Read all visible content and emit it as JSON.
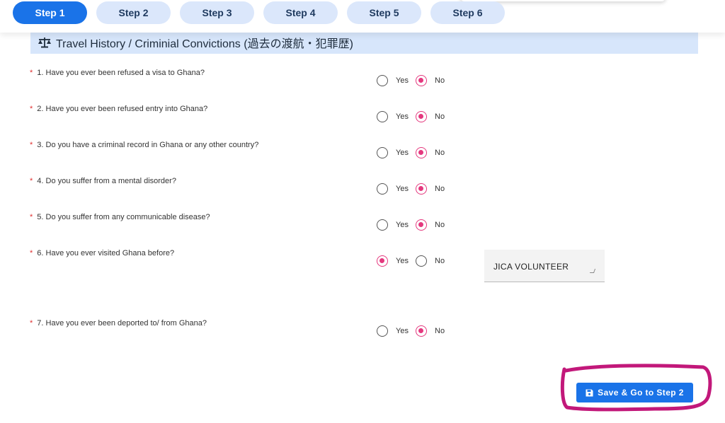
{
  "steps": [
    {
      "label": "Step 1",
      "active": true
    },
    {
      "label": "Step 2",
      "active": false
    },
    {
      "label": "Step 3",
      "active": false
    },
    {
      "label": "Step 4",
      "active": false
    },
    {
      "label": "Step 5",
      "active": false
    },
    {
      "label": "Step 6",
      "active": false
    }
  ],
  "section": {
    "title": "Travel History / Criminial Convictions (過去の渡航・犯罪歴)",
    "icon": "scale-icon"
  },
  "options": {
    "yes": "Yes",
    "no": "No"
  },
  "required_marker": "*",
  "questions": [
    {
      "text": "1. Have you ever been refused a visa to Ghana?",
      "selected": "No"
    },
    {
      "text": "2. Have you ever been refused entry into Ghana?",
      "selected": "No"
    },
    {
      "text": "3. Do you have a criminal record in Ghana or any other country?",
      "selected": "No"
    },
    {
      "text": "4. Do you suffer from a mental disorder?",
      "selected": "No"
    },
    {
      "text": "5. Do you suffer from any communicable disease?",
      "selected": "No"
    },
    {
      "text": "6. Have you ever visited Ghana before?",
      "selected": "Yes",
      "details_value": "JICA VOLUNTEER"
    },
    {
      "text": "7. Have you ever been deported to/ from Ghana?",
      "selected": "No"
    }
  ],
  "save_button": {
    "label": "Save & Go to Step 2",
    "icon": "floppy-disk-icon"
  },
  "colors": {
    "primary": "#1a73e8",
    "step_inactive": "#dbe7fb",
    "section_bg": "#d7e6fb",
    "radio_selected": "#e4387e",
    "required": "#e03131",
    "annotation": "#c2187a"
  }
}
